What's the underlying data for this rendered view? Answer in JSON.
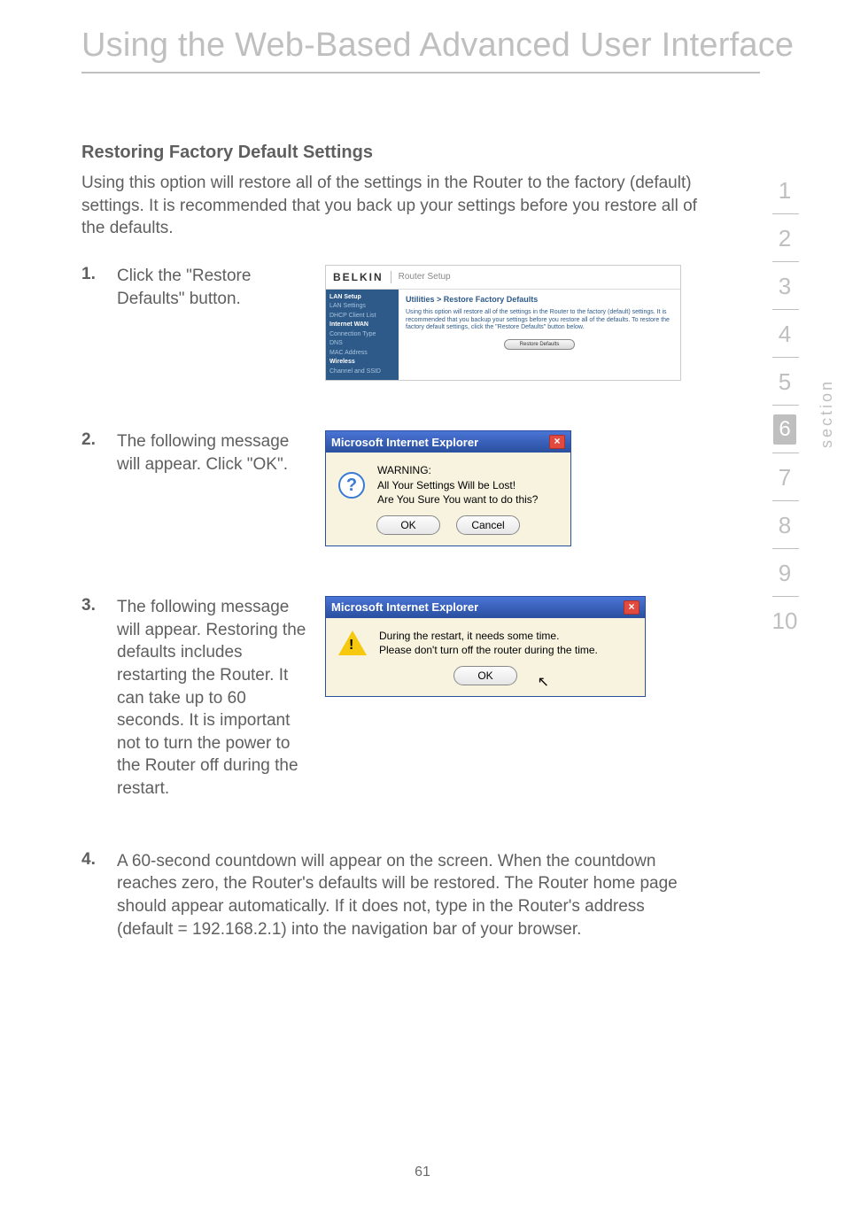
{
  "page": {
    "title": "Using the Web-Based Advanced User Interface",
    "number": "61",
    "section_label": "section",
    "nav": {
      "items": [
        "1",
        "2",
        "3",
        "4",
        "5",
        "6",
        "7",
        "8",
        "9",
        "10"
      ],
      "active": "6"
    }
  },
  "heading": "Restoring Factory Default Settings",
  "intro": "Using this option will restore all of the settings in the Router to the factory (default) settings. It is recommended that you back up your settings before you restore all of the defaults.",
  "steps": {
    "s1": "Click the \"Restore Defaults\" button.",
    "s2": "The following message will appear. Click \"OK\".",
    "s3": "The following message will appear. Restoring the defaults includes restarting the Router. It can take up to 60 seconds. It is important not to turn the power to the Router off during the restart.",
    "s4": "A 60-second countdown will appear on the screen. When the countdown reaches zero, the Router's defaults will be restored. The Router home page should appear automatically. If it does not, type in the Router's address (default = 192.168.2.1) into the navigation bar of your browser."
  },
  "belkin": {
    "logo": "BELKIN",
    "router": "Router Setup",
    "sidebar": {
      "lan_setup": "LAN Setup",
      "lan_settings": "LAN Settings",
      "dhcp": "DHCP Client List",
      "internet_wan": "Internet WAN",
      "conn_type": "Connection Type",
      "dns": "DNS",
      "mac": "MAC Address",
      "wireless": "Wireless",
      "channel": "Channel and SSID"
    },
    "main": {
      "title": "Utilities > Restore Factory Defaults",
      "text": "Using this option will restore all of the settings in the Router to the factory (default) settings. It is recommended that you backup your settings before you restore all of the defaults. To restore the factory default settings, click the \"Restore Defaults\" button below.",
      "button": "Restore Defaults"
    }
  },
  "dialog1": {
    "title": "Microsoft Internet Explorer",
    "close": "×",
    "msg_line1": "WARNING:",
    "msg_line2": "All Your Settings Will be Lost!",
    "msg_line3": "Are You Sure You want to do this?",
    "ok": "OK",
    "cancel": "Cancel"
  },
  "dialog2": {
    "title": "Microsoft Internet Explorer",
    "close": "×",
    "msg_line1": "During the restart, it needs some time.",
    "msg_line2": "Please don't turn off the router during the time.",
    "ok": "OK"
  }
}
